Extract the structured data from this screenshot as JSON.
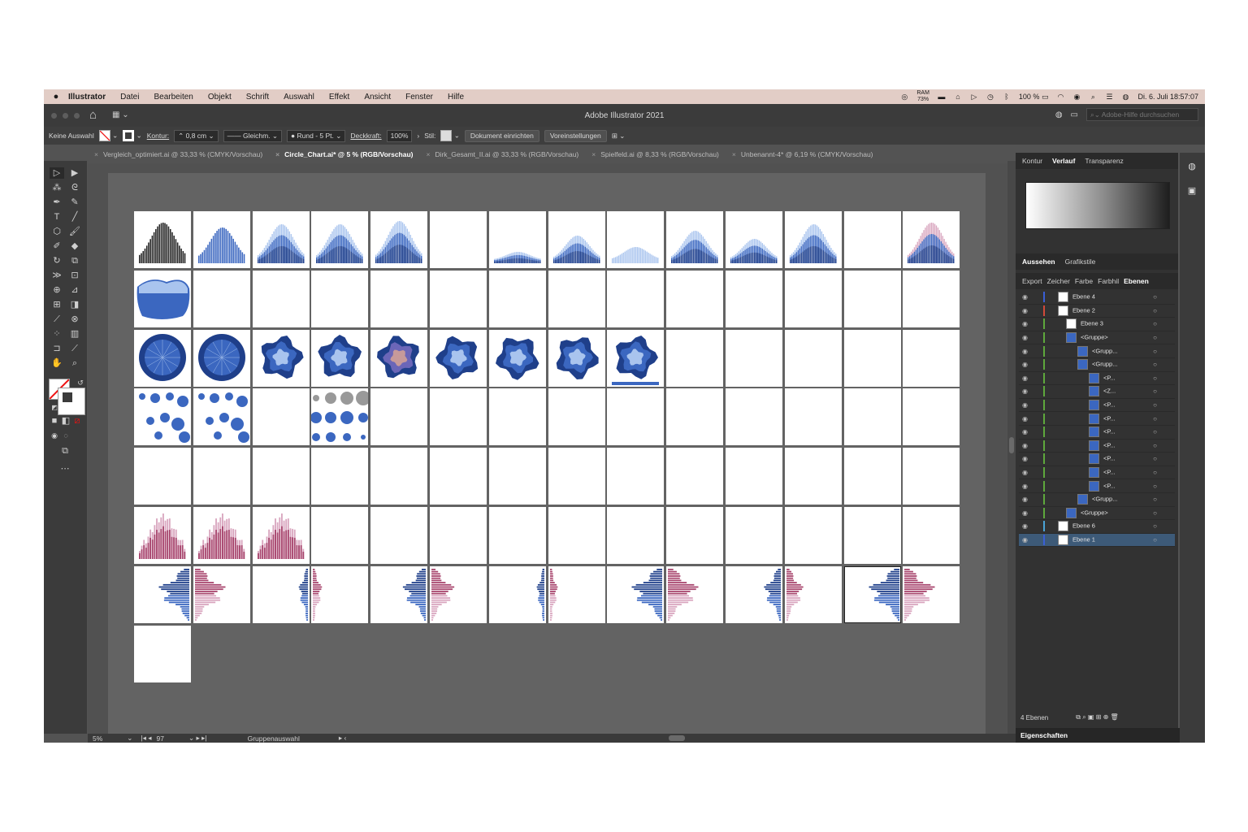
{
  "menubar": {
    "items": [
      "Illustrator",
      "Datei",
      "Bearbeiten",
      "Objekt",
      "Schrift",
      "Auswahl",
      "Effekt",
      "Ansicht",
      "Fenster",
      "Hilfe"
    ],
    "status": {
      "ram_label": "RAM",
      "ram_value": "73%",
      "battery": "100 %",
      "datetime": "Di. 6. Juli  18:57:07"
    }
  },
  "titlebar": {
    "title": "Adobe Illustrator 2021",
    "help_placeholder": "Adobe-Hilfe durchsuchen"
  },
  "control": {
    "selection": "Keine Auswahl",
    "stroke_label": "Kontur:",
    "stroke_value": "0,8 cm",
    "profile": "Gleichm.",
    "brush": "Rund - 5 Pt.",
    "opacity_label": "Deckkraft:",
    "opacity_value": "100%",
    "style_label": "Stil:",
    "doc_setup": "Dokument einrichten",
    "prefs": "Voreinstellungen"
  },
  "tabs": [
    "Vergleich_optimiert.ai @ 33,33 % (CMYK/Vorschau)",
    "Circle_Chart.ai* @ 5 % (RGB/Vorschau)",
    "Dirk_Gesamt_II.ai @ 33,33 % (RGB/Vorschau)",
    "Spielfeld.ai @ 8,33 % (RGB/Vorschau)",
    "Unbenannt-4* @ 6,19 % (CMYK/Vorschau)"
  ],
  "panel": {
    "top_tabs": [
      "Kontur",
      "Verlauf",
      "Transparenz"
    ],
    "mid_tabs": [
      "Aussehen",
      "Grafikstile"
    ],
    "layer_tabs": [
      "Export",
      "Zeicher",
      "Farbe",
      "Farbhil",
      "Ebenen"
    ],
    "layers": [
      {
        "name": "Ebene 4",
        "color": "#3a5fd6"
      },
      {
        "name": "Ebene 2",
        "color": "#d14a3a"
      },
      {
        "name": "Ebene 3",
        "color": "#5ea83c"
      },
      {
        "name": "<Gruppe>",
        "color": "#5ea83c"
      },
      {
        "name": "<Grupp...",
        "color": "#5ea83c"
      },
      {
        "name": "<Grupp...",
        "color": "#5ea83c"
      },
      {
        "name": "<P...",
        "color": "#5ea83c"
      },
      {
        "name": "<Z...",
        "color": "#5ea83c"
      },
      {
        "name": "<P...",
        "color": "#5ea83c"
      },
      {
        "name": "<P...",
        "color": "#5ea83c"
      },
      {
        "name": "<P...",
        "color": "#5ea83c"
      },
      {
        "name": "<P...",
        "color": "#5ea83c"
      },
      {
        "name": "<P...",
        "color": "#5ea83c"
      },
      {
        "name": "<P...",
        "color": "#5ea83c"
      },
      {
        "name": "<P...",
        "color": "#5ea83c"
      },
      {
        "name": "<Grupp...",
        "color": "#5ea83c"
      },
      {
        "name": "<Gruppe>",
        "color": "#5ea83c"
      },
      {
        "name": "Ebene 6",
        "color": "#4aa3d6"
      },
      {
        "name": "Ebene 1",
        "color": "#3a5fd6"
      }
    ],
    "layer_count": "4 Ebenen",
    "properties_tab": "Eigenschaften"
  },
  "status": {
    "zoom": "5%",
    "artboard": "97",
    "mode": "Gruppenauswahl"
  },
  "colors": {
    "blue_dark": "#1f3f8a",
    "blue_mid": "#3b67c0",
    "blue_light": "#a9c4ee",
    "pink": "#a8466e",
    "pink_light": "#d9a6bf"
  }
}
